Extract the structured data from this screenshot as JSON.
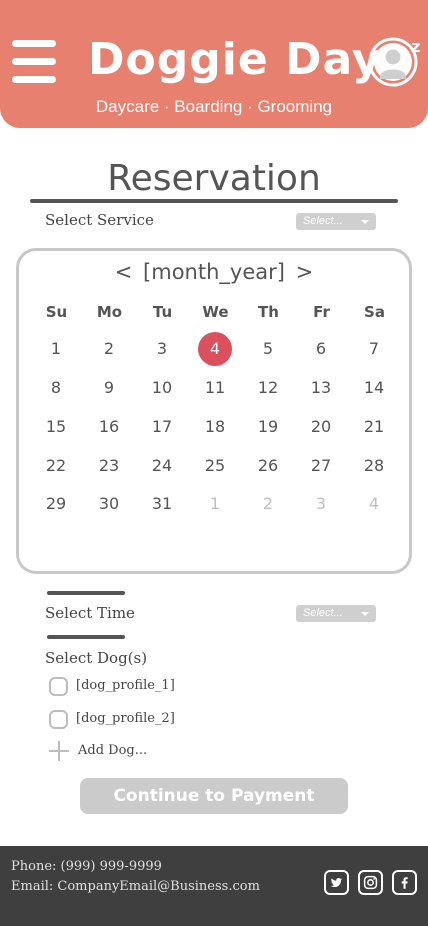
{
  "header": {
    "logo_text": "Doggie Dayz",
    "logo_zz": "z z",
    "tagline": "Daycare · Boarding · Grooming",
    "menu_icon": "hamburger-menu-icon",
    "profile_icon": "user-avatar-icon",
    "bg_color": "#e8806f"
  },
  "page": {
    "title": "Reservation"
  },
  "service": {
    "label": "Select Service",
    "select_placeholder": "Select..."
  },
  "calendar": {
    "month_year": "[month_year]",
    "prev": "<",
    "next": ">",
    "weekdays": [
      "Su",
      "Mo",
      "Tu",
      "We",
      "Th",
      "Fr",
      "Sa"
    ],
    "weeks": [
      [
        "1",
        "2",
        "3",
        "4",
        "5",
        "6",
        "7"
      ],
      [
        "8",
        "9",
        "10",
        "11",
        "12",
        "13",
        "14"
      ],
      [
        "15",
        "16",
        "17",
        "18",
        "19",
        "20",
        "21"
      ],
      [
        "22",
        "23",
        "24",
        "25",
        "26",
        "27",
        "28"
      ],
      [
        "29",
        "30",
        "31",
        "1",
        "2",
        "3",
        "4"
      ]
    ],
    "selected_day": "4",
    "selected_color": "#dc4f5c"
  },
  "time": {
    "label": "Select Time",
    "select_placeholder": "Select..."
  },
  "dogs": {
    "label": "Select Dog(s)",
    "profiles": [
      "[dog_profile_1]",
      "[dog_profile_2]"
    ],
    "add_label": "Add Dog..."
  },
  "continue_label": "Continue to Payment",
  "footer": {
    "phone": "Phone: (999) 999-9999",
    "email": "Email: CompanyEmail@Business.com",
    "social_icons": [
      "twitter-icon",
      "instagram-icon",
      "facebook-icon"
    ],
    "bg_color": "#3f3f40"
  }
}
